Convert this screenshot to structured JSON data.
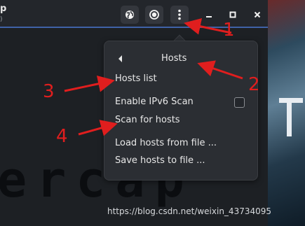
{
  "window": {
    "title": "p",
    "subtitle": ")"
  },
  "toolbar": {
    "buttons": [
      {
        "name": "globe-icon"
      },
      {
        "name": "record-icon"
      },
      {
        "name": "kebab-menu-icon"
      }
    ],
    "window_controls": [
      "minimize",
      "maximize",
      "close"
    ]
  },
  "background_logo": "ercap",
  "popover": {
    "title": "Hosts",
    "items": {
      "hosts_list": "Hosts list",
      "enable_ipv6": "Enable IPv6 Scan",
      "scan_for_hosts": "Scan for hosts",
      "load_hosts": "Load hosts from file ...",
      "save_hosts": "Save hosts to file ..."
    },
    "ipv6_checked": false
  },
  "annotations": [
    "1",
    "2",
    "3",
    "4"
  ],
  "watermark": "https://blog.csdn.net/weixin_43734095",
  "colors": {
    "accent_line": "#3f62a7",
    "annotation_red": "#e01e1e",
    "popover_bg": "#2b2e33"
  }
}
